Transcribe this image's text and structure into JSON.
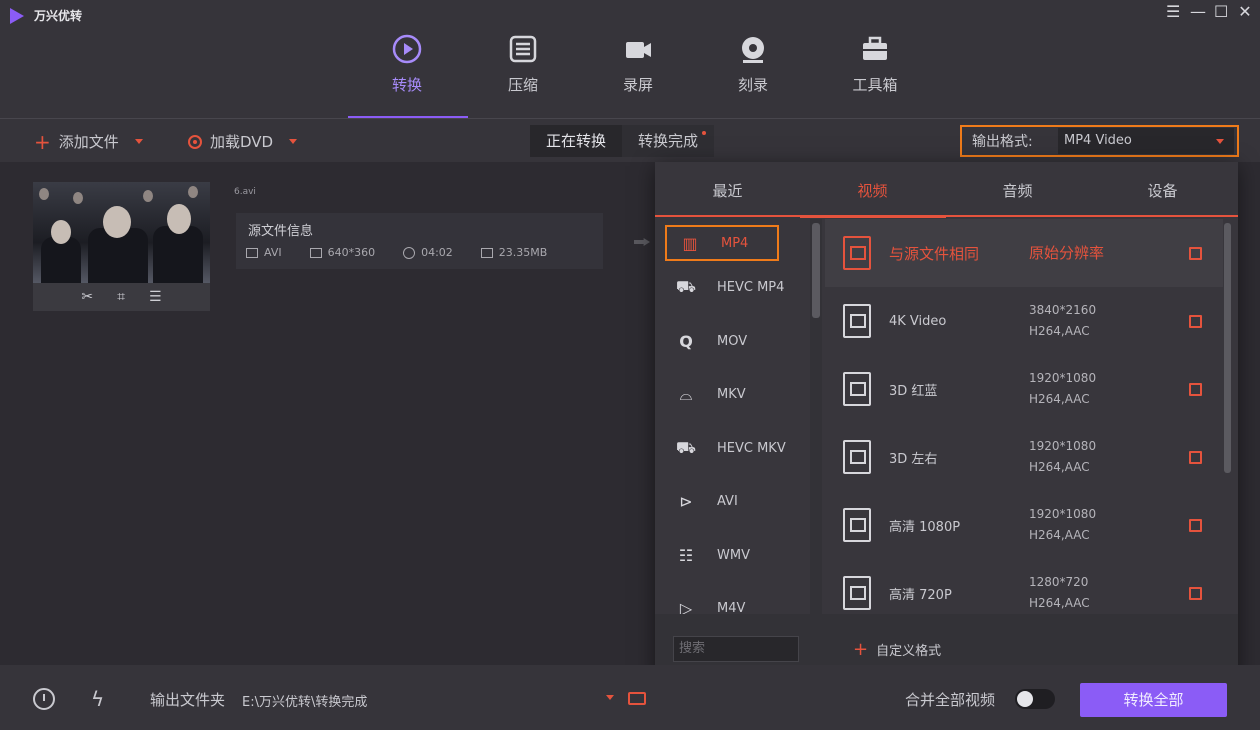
{
  "app": {
    "title": "万兴优转",
    "accent": "#8b5cf6",
    "alert": "#e5533d",
    "highlight": "#ef7b1a"
  },
  "window_controls": [
    "☰",
    "—",
    "☐",
    "✕"
  ],
  "nav": {
    "items": [
      {
        "label": "转换",
        "icon": "convert-icon"
      },
      {
        "label": "压缩",
        "icon": "compress-icon"
      },
      {
        "label": "录屏",
        "icon": "record-screen-icon"
      },
      {
        "label": "刻录",
        "icon": "burn-icon"
      },
      {
        "label": "工具箱",
        "icon": "toolbox-icon"
      }
    ],
    "active": "转换"
  },
  "toolbar": {
    "add_file": "添加文件",
    "load_dvd": "加载DVD",
    "tab_converting": "正在转换",
    "tab_done": "转换完成",
    "output_format_label": "输出格式:",
    "output_format_value": "MP4 Video"
  },
  "file": {
    "name": "6.avi",
    "source_label": "源文件信息",
    "format": "AVI",
    "resolution": "640*360",
    "duration": "04:02",
    "size": "23.35MB"
  },
  "popup": {
    "tabs": [
      "最近",
      "视频",
      "音频",
      "设备"
    ],
    "active_tab": "视频",
    "formats": [
      {
        "label": "MP4",
        "icon": "film-icon"
      },
      {
        "label": "HEVC MP4",
        "icon": "hevc-icon"
      },
      {
        "label": "MOV",
        "icon": "quicktime-icon"
      },
      {
        "label": "MKV",
        "icon": "mkv-icon"
      },
      {
        "label": "HEVC MKV",
        "icon": "hevc-icon"
      },
      {
        "label": "AVI",
        "icon": "play-circle-icon"
      },
      {
        "label": "WMV",
        "icon": "clapper-icon"
      },
      {
        "label": "M4V",
        "icon": "m4v-icon"
      }
    ],
    "selected_format": "MP4",
    "presets": [
      {
        "name": "与源文件相同",
        "res": "原始分辨率",
        "codec": ""
      },
      {
        "name": "4K Video",
        "res": "3840*2160",
        "codec": "H264,AAC"
      },
      {
        "name": "3D 红蓝",
        "res": "1920*1080",
        "codec": "H264,AAC"
      },
      {
        "name": "3D 左右",
        "res": "1920*1080",
        "codec": "H264,AAC"
      },
      {
        "name": "高清 1080P",
        "res": "1920*1080",
        "codec": "H264,AAC"
      },
      {
        "name": "高清 720P",
        "res": "1280*720",
        "codec": "H264,AAC"
      }
    ],
    "search_placeholder": "搜索",
    "custom_label": "自定义格式"
  },
  "bottom": {
    "output_folder_label": "输出文件夹",
    "output_path": "E:\\万兴优转\\转换完成",
    "merge_label": "合并全部视频",
    "merge_enabled": false,
    "convert_all": "转换全部"
  }
}
